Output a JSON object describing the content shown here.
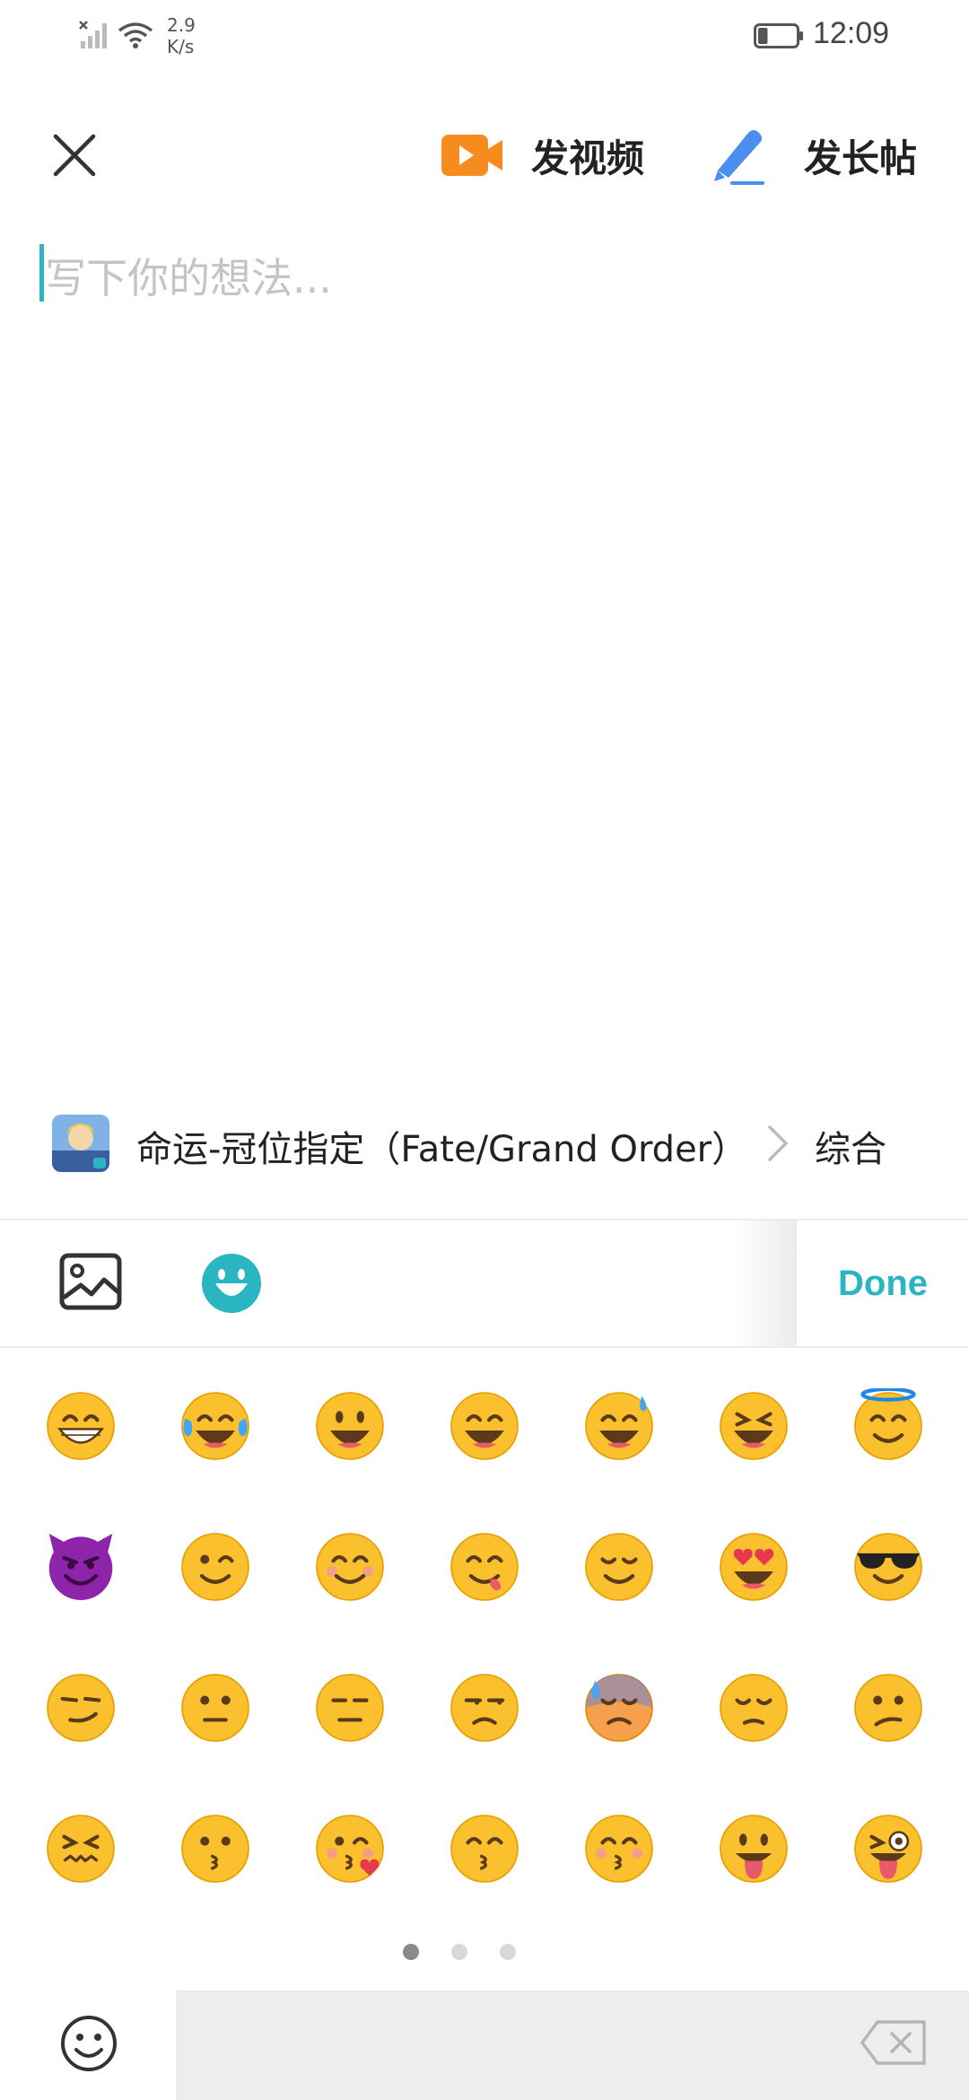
{
  "status_bar": {
    "network_speed": "2.9",
    "network_unit": "K/s",
    "time": "12:09",
    "battery_level": 0.25
  },
  "header": {
    "video_label": "发视频",
    "long_post_label": "发长帖"
  },
  "editor": {
    "placeholder": "写下你的想法..."
  },
  "forum": {
    "name": "命运-冠位指定（Fate/Grand Order）",
    "category": "综合"
  },
  "toolbar": {
    "done_label": "Done"
  },
  "emojis": [
    "grinning-teeth",
    "tears-of-joy",
    "smiley",
    "big-smile",
    "sweat-smile",
    "laughing",
    "halo",
    "smiling-imp",
    "wink",
    "blush",
    "yum",
    "relieved",
    "heart-eyes",
    "sunglasses",
    "smirk",
    "neutral",
    "expressionless",
    "unamused",
    "cold-sweat",
    "pensive",
    "confused",
    "confounded",
    "kissing",
    "kissing-heart",
    "kissing-smiling-eyes",
    "kissing-closed-eyes",
    "tongue-out",
    "tongue-wink"
  ],
  "pagination": {
    "pages": 3,
    "current": 1
  },
  "colors": {
    "accent": "#2bb5c2",
    "video_icon": "#f68b1e",
    "pen_icon": "#4a8ef0",
    "emoji_face": "#fbc02d",
    "imp": "#8e24aa"
  }
}
